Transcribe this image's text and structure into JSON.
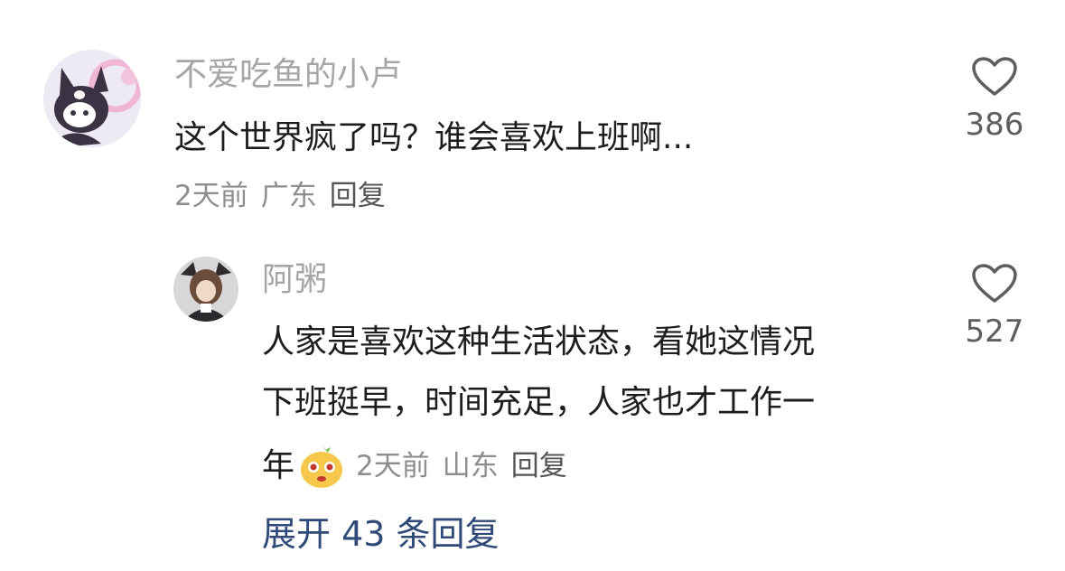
{
  "comment": {
    "username": "不爱吃鱼的小卢",
    "text": "这个世界疯了吗？谁会喜欢上班啊...",
    "time": "2天前",
    "location": "广东",
    "reply_label": "回复",
    "like_count": "386",
    "like_icon": "heart-outline-icon",
    "avatar_icon": "kuromi-avatar"
  },
  "reply": {
    "username": "阿粥",
    "lines": [
      "人家是喜欢这种生活状态，看她这情况",
      "下班挺早，时间充足，人家也才工作一",
      "年"
    ],
    "emoji_icon": "smiling-emoji-icon",
    "time": "2天前",
    "location": "山东",
    "reply_label": "回复",
    "like_count": "527",
    "like_icon": "heart-outline-icon",
    "avatar_icon": "anime-character-avatar"
  },
  "expand": {
    "label": "展开 43 条回复"
  },
  "colors": {
    "username": "#a6a6a6",
    "text": "#1d1d1d",
    "meta": "#8e8e8e",
    "link": "#2f4a79"
  }
}
